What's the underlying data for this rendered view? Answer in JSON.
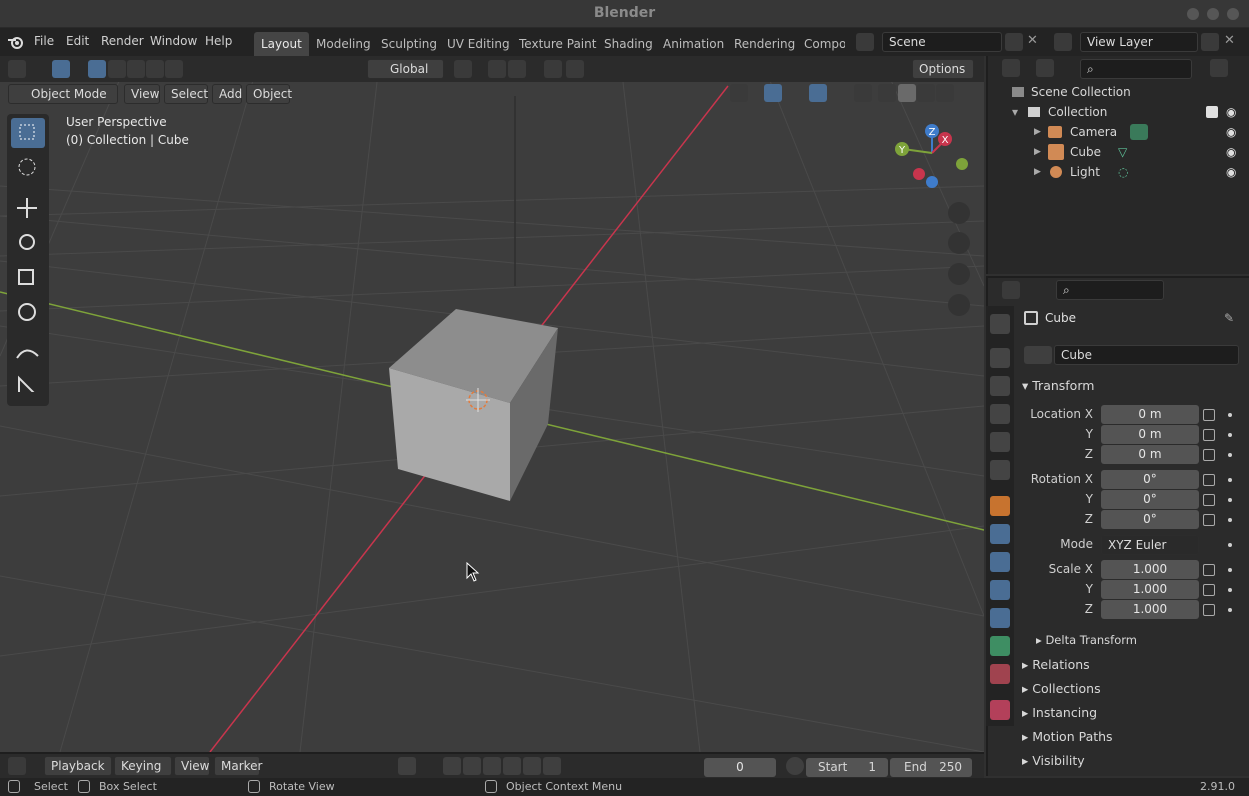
{
  "app": {
    "title": "Blender",
    "version": "2.91.0"
  },
  "menu": [
    "File",
    "Edit",
    "Render",
    "Window",
    "Help"
  ],
  "workspaces": [
    "Layout",
    "Modeling",
    "Sculpting",
    "UV Editing",
    "Texture Paint",
    "Shading",
    "Animation",
    "Rendering",
    "Compos"
  ],
  "scene": {
    "name": "Scene",
    "view_layer": "View Layer"
  },
  "viewport": {
    "mode": "Object Mode",
    "menus": [
      "View",
      "Select",
      "Add",
      "Object"
    ],
    "orientation": "Global",
    "options_label": "Options",
    "overlay_line1": "User Perspective",
    "overlay_line2": "(0) Collection | Cube",
    "gizmo_axes": {
      "x": "X",
      "y": "Y",
      "z": "Z"
    }
  },
  "outliner": {
    "scene_collection": "Scene Collection",
    "collection": "Collection",
    "items": [
      "Camera",
      "Cube",
      "Light"
    ]
  },
  "properties": {
    "object_name": "Cube",
    "data_name": "Cube",
    "transform_label": "Transform",
    "location": {
      "label": "Location X",
      "x": "0 m",
      "y": "0 m",
      "z": "0 m"
    },
    "rotation": {
      "label": "Rotation X",
      "x": "0°",
      "y": "0°",
      "z": "0°"
    },
    "mode_label": "Mode",
    "mode_value": "XYZ Euler",
    "scale": {
      "label": "Scale X",
      "x": "1.000",
      "y": "1.000",
      "z": "1.000"
    },
    "axis_y": "Y",
    "axis_z": "Z",
    "delta_transform": "Delta Transform",
    "sections": [
      "Relations",
      "Collections",
      "Instancing",
      "Motion Paths",
      "Visibility"
    ]
  },
  "timeline": {
    "menus": [
      "Playback",
      "Keying",
      "View",
      "Marker"
    ],
    "current_frame": "0",
    "start_label": "Start",
    "start": "1",
    "end_label": "End",
    "end": "250"
  },
  "statusbar": {
    "select": "Select",
    "box_select": "Box Select",
    "rotate_view": "Rotate View",
    "context_menu": "Object Context Menu"
  },
  "colors": {
    "accent": "#4a6d94",
    "x_axis": "#c8354d",
    "y_axis": "#7ea33a",
    "z_axis": "#3f7ccb"
  }
}
